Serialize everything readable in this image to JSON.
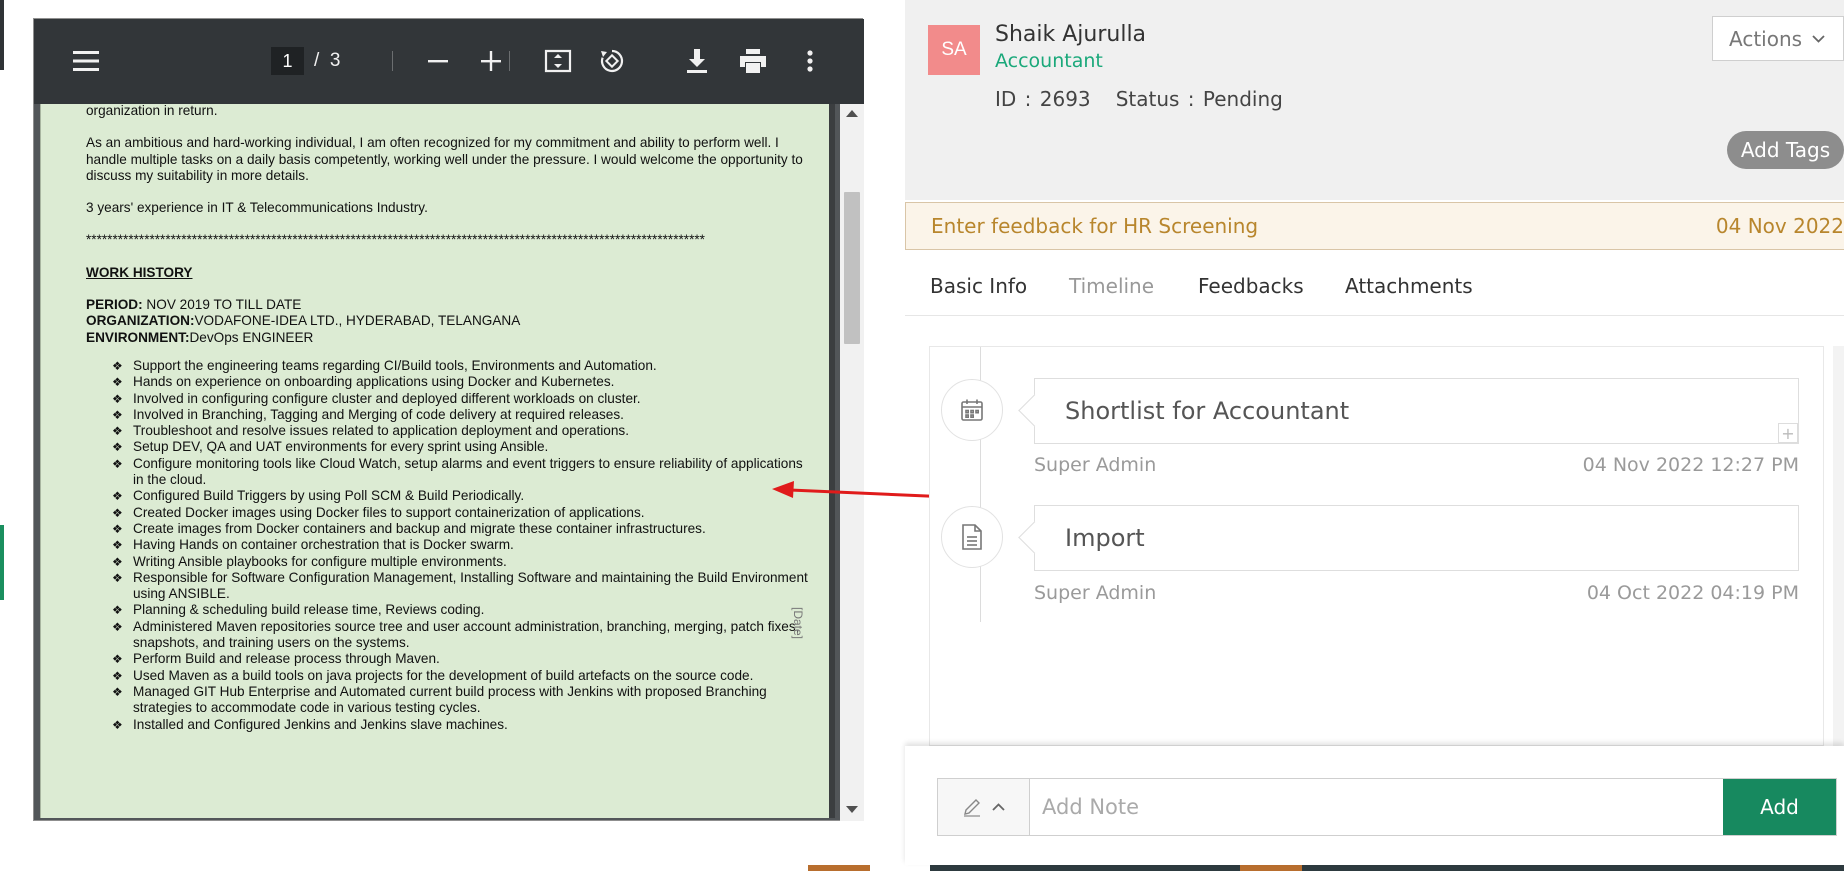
{
  "pdf_viewer": {
    "current_page": "1",
    "page_separator": "/",
    "total_pages": "3",
    "content": {
      "intro_line": "organization in return.",
      "summary": "As an ambitious and hard-working individual, I am often recognized for my commitment and ability to perform well. I handle multiple tasks on a daily basis competently, working well under the pressure. I would welcome the opportunity to discuss my suitability in more details.",
      "experience": "3 years' experience in IT & Telecommunications Industry.",
      "stars": "*********************************************************************************************************************",
      "work_history_heading": "WORK HISTORY",
      "period_label": "PERIOD:",
      "period_value": " NOV 2019 TO TILL DATE",
      "org_label": "ORGANIZATION:",
      "org_value": "VODAFONE-IDEA LTD., HYDERABAD, TELANGANA",
      "env_label": "ENVIRONMENT:",
      "env_value": "DevOps ENGINEER",
      "bullets": [
        "Support the engineering teams regarding CI/Build tools, Environments and Automation.",
        "Hands on experience on onboarding applications using Docker and Kubernetes.",
        "Involved in configuring configure cluster and deployed different workloads on cluster.",
        "Involved in Branching, Tagging and Merging of code delivery at required releases.",
        "Troubleshoot and resolve issues related to application deployment and operations.",
        "Setup DEV, QA and UAT environments for every sprint using Ansible.",
        "Configure monitoring tools like Cloud Watch, setup alarms and event triggers to ensure reliability of applications in the cloud.",
        "Configured Build Triggers by using Poll SCM & Build Periodically.",
        "Created Docker images using Docker files to support containerization of applications.",
        "Create images from Docker containers and backup and migrate these container infrastructures.",
        "Having Hands on container orchestration that is Docker swarm.",
        "Writing Ansible playbooks for configure multiple environments.",
        "Responsible for Software Configuration Management, Installing Software and maintaining the Build Environment using ANSIBLE.",
        "Planning & scheduling build release time, Reviews coding.",
        "Administered Maven repositories source tree and user account administration, branching, merging, patch fixes, snapshots, and training users on the systems.",
        "Perform Build and release process through Maven.",
        "Used Maven as a build tools on java projects for the development of build artefacts on the source code.",
        "Managed GIT Hub Enterprise and Automated current build process with Jenkins with proposed Branching strategies to accommodate code in various testing cycles.",
        "Installed and Configured Jenkins and Jenkins slave machines."
      ],
      "date_tag": "[Date]"
    }
  },
  "candidate": {
    "initials": "SA",
    "name": "Shaik Ajurulla",
    "role": "Accountant",
    "id_line": "ID : 2693   Status : Pending",
    "actions_label": "Actions",
    "add_tags_label": "Add Tags"
  },
  "feedback_bar": {
    "text": "Enter feedback for HR Screening",
    "date": "04 Nov 2022"
  },
  "tabs": [
    {
      "label": "Basic Info"
    },
    {
      "label": "Timeline"
    },
    {
      "label": "Feedbacks"
    },
    {
      "label": "Attachments"
    }
  ],
  "timeline": [
    {
      "title": "Shortlist for Accountant",
      "user": "Super Admin",
      "datetime": "04 Nov 2022 12:27 PM",
      "icon": "calendar-icon"
    },
    {
      "title": "Import",
      "user": "Super Admin",
      "datetime": "04 Oct 2022 04:19 PM",
      "icon": "document-icon"
    }
  ],
  "note": {
    "placeholder": "Add Note",
    "add_label": "Add"
  },
  "colors": {
    "accent_green": "#17895f",
    "role_green": "#1aa87a",
    "avatar_bg": "#f28b8b",
    "feedback_text": "#b8862d",
    "pdf_page_bg": "#dcebd3",
    "arrow_red": "#e01b1b"
  }
}
